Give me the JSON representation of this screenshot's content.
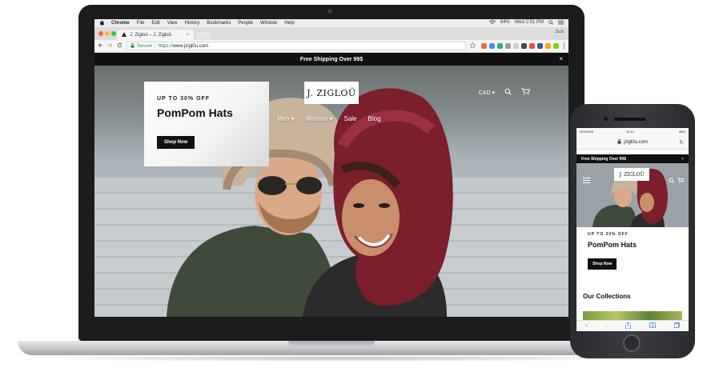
{
  "mac_menubar": {
    "apple": "",
    "app": "Chrome",
    "items": [
      "File",
      "Edit",
      "View",
      "History",
      "Bookmarks",
      "People",
      "Window",
      "Help"
    ],
    "battery": "84%",
    "clock": "Wed 2:51 PM"
  },
  "browser": {
    "tab_title": "J. Zigloü – J. Zigloü",
    "tab_close": "×",
    "profile_name": "Just",
    "secure_label": "Secure",
    "url_scheme": "https://",
    "url_host": "www.jzigl0u.com"
  },
  "site": {
    "announcement": "Free Shipping Over 99$",
    "announcement_close": "×",
    "logo": "J. ZIGLOÜ",
    "nav": [
      "Men",
      "Women",
      "Sale",
      "Blog"
    ],
    "currency": "CAD",
    "promo": {
      "eyebrow": "UP TO 30% OFF",
      "title": "PomPom Hats",
      "cta": "Shop Now"
    }
  },
  "mobile": {
    "carrier": "ROGERS",
    "time": "10:12",
    "battery": "58%",
    "url": "jzigl0u.com",
    "announcement": "Free Shipping Over 99$",
    "announcement_close": "×",
    "logo": "J. ZIGLOÜ",
    "promo": {
      "eyebrow": "UP TO 30% OFF",
      "title": "PomPom Hats",
      "cta": "Shop Now"
    },
    "collections_heading": "Our Collections"
  },
  "icons": {
    "search": "search-icon",
    "cart": "cart-icon",
    "close": "close-icon",
    "menu": "hamburger-icon"
  },
  "colors": {
    "announcement_bg": "#111111",
    "button_bg": "#111111",
    "secure_green": "#1a8a3e"
  }
}
